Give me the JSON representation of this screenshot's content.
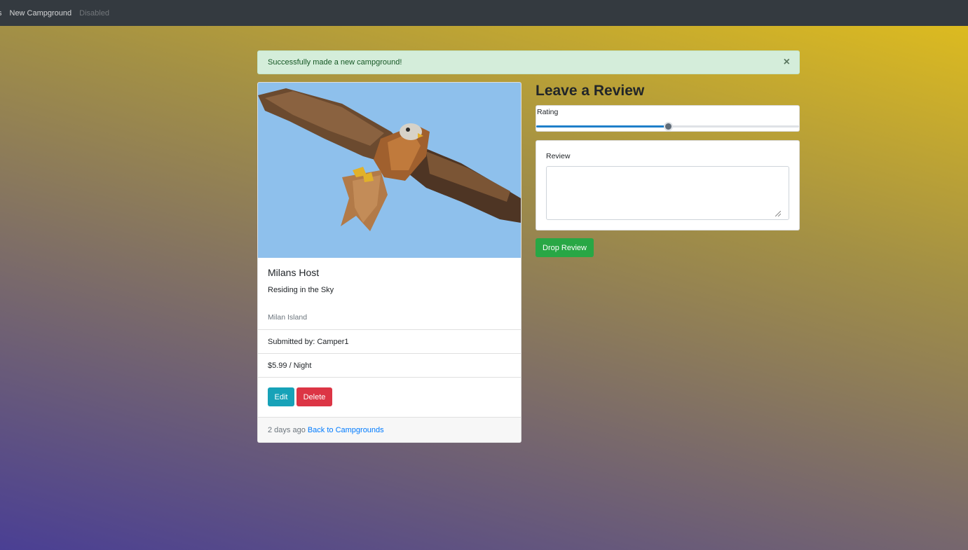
{
  "navbar": {
    "items": [
      {
        "label": "s",
        "state": "cut-off"
      },
      {
        "label": "New Campground",
        "state": "normal"
      },
      {
        "label": "Disabled",
        "state": "disabled"
      }
    ]
  },
  "alert": {
    "message": "Successfully made a new campground!",
    "close_label": "×"
  },
  "campground": {
    "image_subject": "red kite bird in flight against blue sky",
    "title": "Milans Host",
    "description": "Residing in the Sky",
    "location": "Milan Island",
    "submitted_by": "Submitted by: Camper1",
    "price": "$5.99 / Night",
    "edit_label": "Edit",
    "delete_label": "Delete",
    "posted_ago": "2 days ago",
    "back_link": "Back to Campgrounds"
  },
  "review_form": {
    "heading": "Leave a Review",
    "rating_label": "Rating",
    "rating_value": 3,
    "rating_min": 1,
    "rating_max": 5,
    "review_label": "Review",
    "review_value": "",
    "submit_label": "Drop Review"
  },
  "colors": {
    "navbar": "#343a40",
    "alert_bg": "#d4edda",
    "edit": "#17a2b8",
    "delete": "#dc3545",
    "submit": "#28a745",
    "link": "#007bff"
  }
}
